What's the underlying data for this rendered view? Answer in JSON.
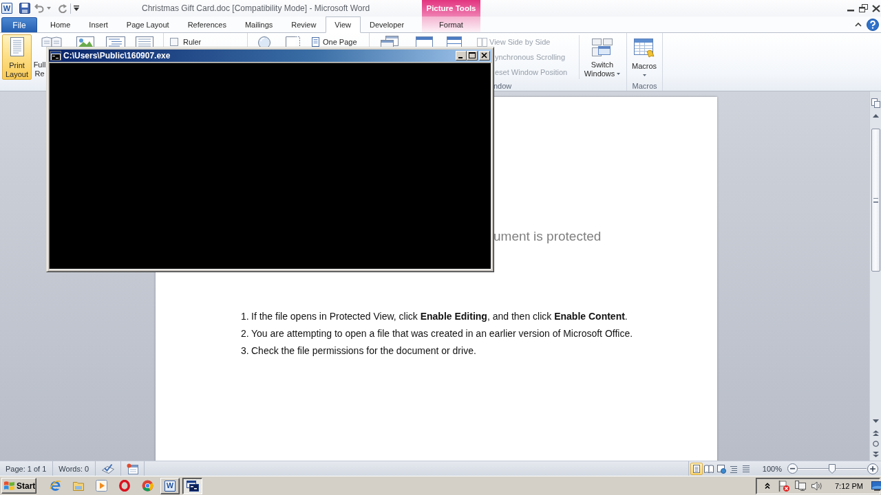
{
  "title_bar": {
    "app_logo": "W",
    "title": "Christmas Gift Card.doc [Compatibility Mode] - Microsoft Word",
    "contextual_group": "Picture Tools"
  },
  "ribbon_tabs": [
    {
      "label": "File",
      "kind": "backstage",
      "selected": false
    },
    {
      "label": "Home",
      "kind": "standard",
      "selected": false
    },
    {
      "label": "Insert",
      "kind": "standard",
      "selected": false
    },
    {
      "label": "Page Layout",
      "kind": "standard",
      "selected": false
    },
    {
      "label": "References",
      "kind": "standard",
      "selected": false
    },
    {
      "label": "Mailings",
      "kind": "standard",
      "selected": false
    },
    {
      "label": "Review",
      "kind": "standard",
      "selected": false
    },
    {
      "label": "View",
      "kind": "standard",
      "selected": true
    },
    {
      "label": "Developer",
      "kind": "standard",
      "selected": false
    },
    {
      "label": "Format",
      "kind": "contextual",
      "selected": false
    }
  ],
  "ribbon": {
    "print_layout": {
      "lines": [
        "Print",
        "Layout"
      ],
      "selected": true
    },
    "full_reading": {
      "lines": [
        "Full",
        "Re"
      ]
    },
    "ruler": {
      "label": "Ruler",
      "checked": false
    },
    "one_page": {
      "label": "One Page"
    },
    "window_commands": [
      {
        "label": "View Side by Side",
        "kind": "icon_text",
        "disabled": true
      },
      {
        "label": "ynchronous Scrolling",
        "kind": "text_only",
        "disabled": true
      },
      {
        "label": "eset Window Position",
        "kind": "text_only",
        "disabled": true
      }
    ],
    "window_group_label": "ndow",
    "switch_windows": {
      "lines": [
        "Switch",
        "Windows"
      ]
    },
    "macros": {
      "label": "Macros",
      "group_label": "Macros"
    }
  },
  "console_window": {
    "title": "C:\\Users\\Public\\160907.exe"
  },
  "document": {
    "heading": "ument is protected",
    "steps": [
      {
        "number": "1.",
        "text": "If the file opens in Protected View, click **Enable Editing**, and then click **Enable Content**."
      },
      {
        "number": "2.",
        "text": "You are attempting to open a file that was created in an earlier version of Microsoft Office."
      },
      {
        "number": "3.",
        "text": "Check the file permissions for the document or drive."
      }
    ]
  },
  "status_bar": {
    "page": "Page: 1 of 1",
    "words": "Words: 0",
    "view_buttons": [
      {
        "kind": "print_layout",
        "selected": true
      },
      {
        "kind": "full_reading",
        "selected": false
      },
      {
        "kind": "web_layout",
        "selected": false
      },
      {
        "kind": "outline",
        "selected": false
      },
      {
        "kind": "draft",
        "selected": false
      }
    ],
    "zoom_label": "100%",
    "zoom": {
      "level": 0.5
    }
  },
  "taskbar": {
    "start": "Start",
    "tasks": [
      {
        "kind": "word",
        "logo": "W",
        "selected": false
      },
      {
        "kind": "console",
        "selected": true
      }
    ],
    "clock": "7:12 PM"
  }
}
